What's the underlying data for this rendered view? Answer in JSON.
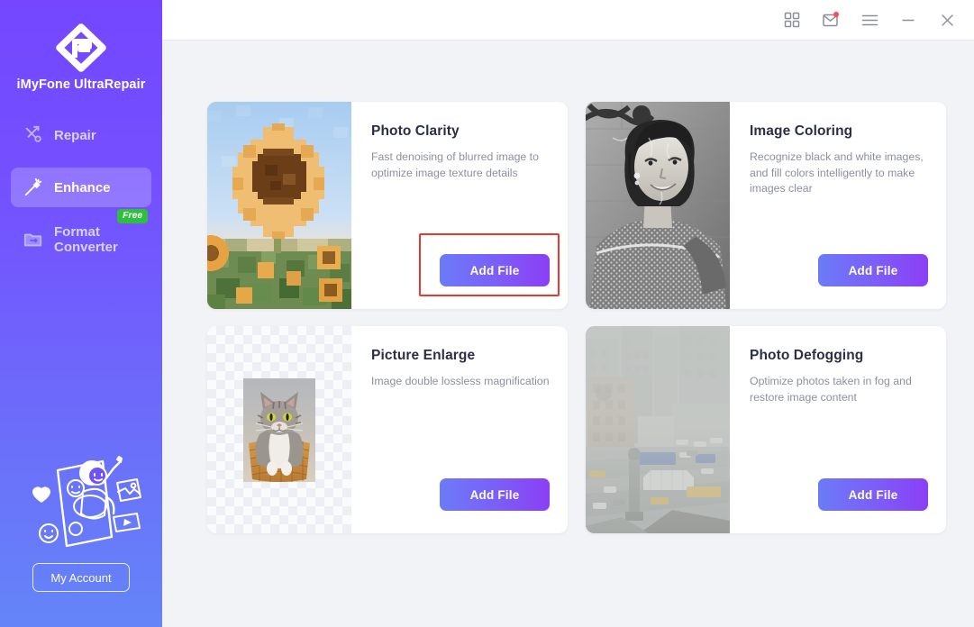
{
  "sidebar": {
    "app_title": "iMyFone UltraRepair",
    "logo_icon": "ultrarepair-logo-icon",
    "nav_items": [
      {
        "label": "Repair",
        "icon": "wrench-screwdriver-icon",
        "active": false,
        "badge": null
      },
      {
        "label": "Enhance",
        "icon": "magic-wand-icon",
        "active": true,
        "badge": null
      },
      {
        "label": "Format Converter",
        "icon": "folder-convert-icon",
        "active": false,
        "badge": "Free"
      }
    ],
    "illustration_icon": "person-photo-illustration",
    "account_button": "My Account",
    "colors": {
      "gradient_top": "#7447FF",
      "gradient_bottom": "#6485F8",
      "active_item_bg": "rgba(255,255,255,0.22)",
      "badge_green": "#2FBE3D"
    }
  },
  "titlebar": {
    "buttons": [
      {
        "name": "grid-apps-icon",
        "label": ""
      },
      {
        "name": "mail-envelope-icon",
        "label": "",
        "has_notification": true
      },
      {
        "name": "hamburger-menu-icon",
        "label": ""
      },
      {
        "name": "minimize-icon",
        "label": ""
      },
      {
        "name": "close-icon",
        "label": ""
      }
    ]
  },
  "main": {
    "background_color": "#F2F3F7",
    "cards": [
      {
        "title": "Photo Clarity",
        "description": "Fast denoising of blurred image to optimize image texture details",
        "button_label": "Add File",
        "thumbnail": "pixelated-sunflower-field",
        "highlighted": true
      },
      {
        "title": "Image Coloring",
        "description": "Recognize black and white images, and fill colors intelligently to make images clear",
        "button_label": "Add File",
        "thumbnail": "black-and-white-portrait",
        "highlighted": false
      },
      {
        "title": "Picture Enlarge",
        "description": "Image double lossless magnification",
        "button_label": "Add File",
        "thumbnail": "cat-in-basket-transparent",
        "highlighted": false
      },
      {
        "title": "Photo Defogging",
        "description": "Optimize photos taken in fog and restore image content",
        "button_label": "Add File",
        "thumbnail": "foggy-city-street",
        "highlighted": false
      }
    ],
    "button_gradient": {
      "from": "#6C7BF7",
      "to": "#8B3FF5"
    },
    "highlight_color": "#E8392E"
  }
}
